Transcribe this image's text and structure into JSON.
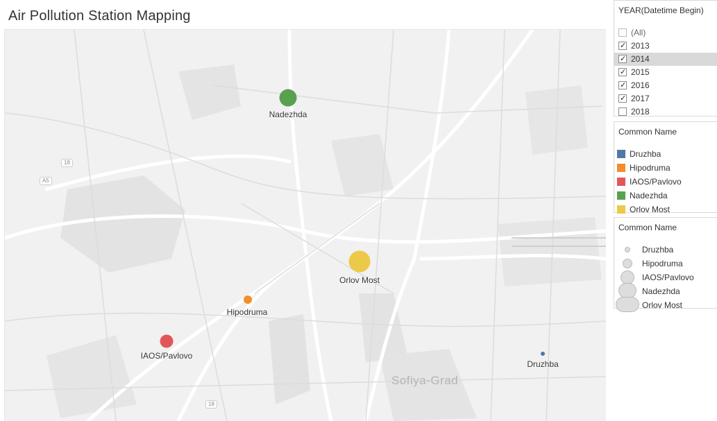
{
  "title": "Air Pollution Station Mapping",
  "map": {
    "city_label": "Sofiya-Grad",
    "road_shields": [
      "18",
      "A5",
      "18"
    ],
    "stations": [
      {
        "name": "Nadezhda",
        "color": "#59a14f",
        "value_rank": 4
      },
      {
        "name": "Orlov Most",
        "color": "#edc948",
        "value_rank": 5
      },
      {
        "name": "Hipodruma",
        "color": "#f28e2b",
        "value_rank": 2
      },
      {
        "name": "IAOS/Pavlovo",
        "color": "#e15759",
        "value_rank": 3
      },
      {
        "name": "Druzhba",
        "color": "#4e79a7",
        "value_rank": 1
      }
    ]
  },
  "year_filter": {
    "title": "YEAR(Datetime Begin)",
    "options": [
      {
        "label": "(All)",
        "checked": false
      },
      {
        "label": "2013",
        "checked": true
      },
      {
        "label": "2014",
        "checked": true
      },
      {
        "label": "2015",
        "checked": true
      },
      {
        "label": "2016",
        "checked": true
      },
      {
        "label": "2017",
        "checked": true
      },
      {
        "label": "2018",
        "checked": false
      }
    ]
  },
  "color_legend": {
    "title": "Common Name",
    "items": [
      {
        "label": "Druzhba",
        "color": "#4e79a7"
      },
      {
        "label": "Hipodruma",
        "color": "#f28e2b"
      },
      {
        "label": "IAOS/Pavlovo",
        "color": "#e15759"
      },
      {
        "label": "Nadezhda",
        "color": "#59a14f"
      },
      {
        "label": "Orlov Most",
        "color": "#edc948"
      }
    ]
  },
  "size_legend": {
    "title": "Common Name",
    "items": [
      {
        "label": "Druzhba"
      },
      {
        "label": "Hipodruma"
      },
      {
        "label": "IAOS/Pavlovo"
      },
      {
        "label": "Nadezhda"
      },
      {
        "label": "Orlov Most"
      }
    ]
  }
}
